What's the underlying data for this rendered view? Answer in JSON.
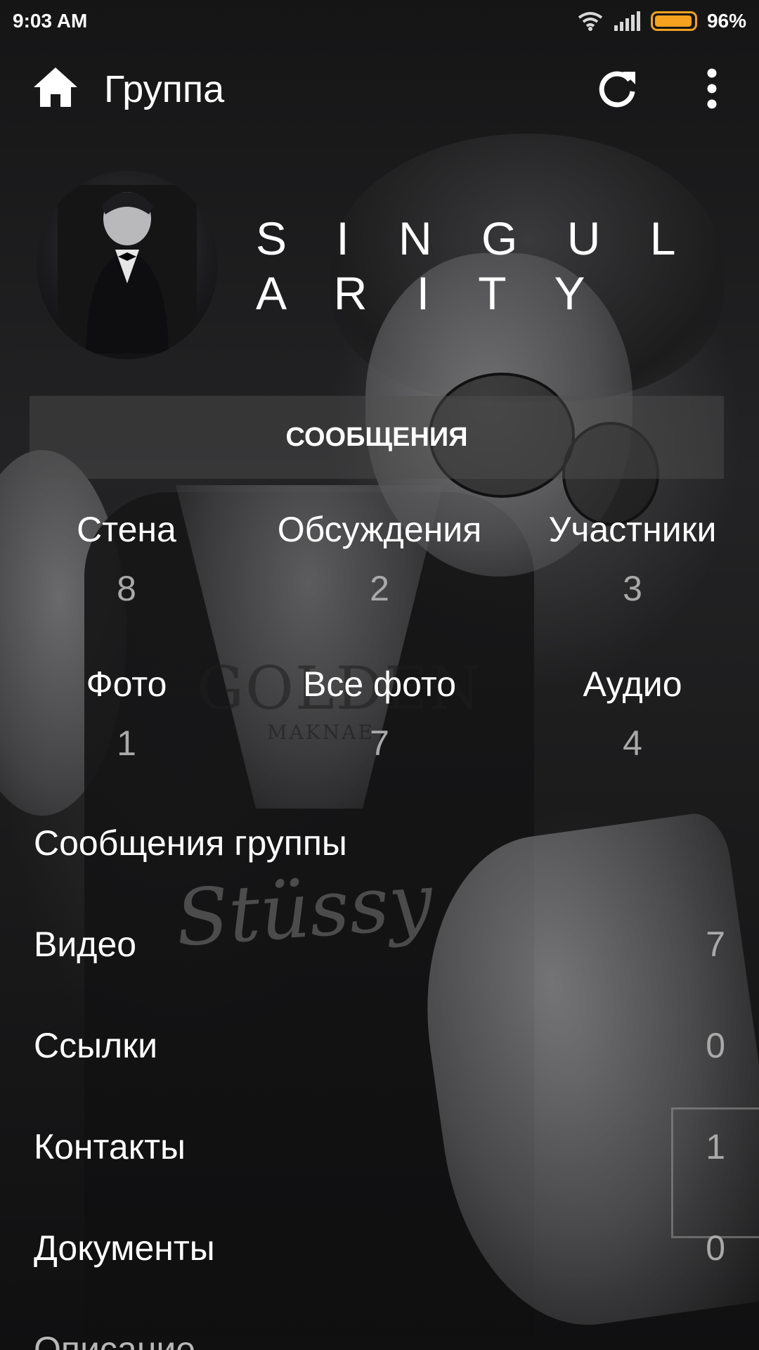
{
  "status_bar": {
    "time": "9:03 AM",
    "battery_percent": "96%",
    "battery_level": 0.96,
    "icons": [
      "wifi-icon",
      "signal-icon",
      "battery-icon"
    ]
  },
  "app_bar": {
    "title": "Группа",
    "icons": [
      "home-icon",
      "refresh-icon",
      "more-vertical-icon"
    ]
  },
  "group": {
    "name": "S I N G U L A R I T Y"
  },
  "messages_button": {
    "label": "СООБЩЕНИЯ"
  },
  "stats": [
    {
      "label": "Стена",
      "value": "8"
    },
    {
      "label": "Обсуждения",
      "value": "2"
    },
    {
      "label": "Участники",
      "value": "3"
    },
    {
      "label": "Фото",
      "value": "1"
    },
    {
      "label": "Все фото",
      "value": "7"
    },
    {
      "label": "Аудио",
      "value": "4"
    }
  ],
  "list": [
    {
      "label": "Сообщения группы",
      "value": ""
    },
    {
      "label": "Видео",
      "value": "7"
    },
    {
      "label": "Ссылки",
      "value": "0"
    },
    {
      "label": "Контакты",
      "value": "1"
    },
    {
      "label": "Документы",
      "value": "0"
    },
    {
      "label": "Описание",
      "value": ""
    }
  ],
  "colors": {
    "accent_battery": "#f6a21e",
    "text_primary": "#ffffff",
    "text_secondary": "#a9a9a9"
  }
}
